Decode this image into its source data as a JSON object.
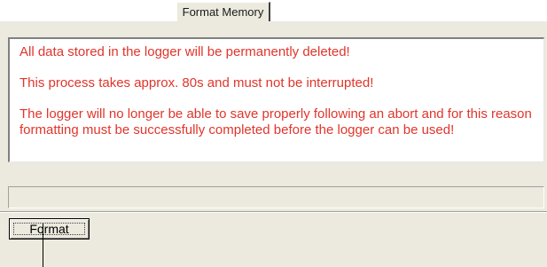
{
  "tabs": [
    {
      "label": "Format Memory",
      "active": true
    }
  ],
  "warning": {
    "color": "#e0352b",
    "lines": [
      "All data stored in the logger will be permanently deleted!",
      "This process takes approx. 80s and must not be interrupted!",
      "The logger will no longer be able to save properly following an abort and for this reason formatting must be successfully completed before the logger can be used!"
    ]
  },
  "progress": {
    "value": 0
  },
  "actions": {
    "format_label": "Format"
  }
}
